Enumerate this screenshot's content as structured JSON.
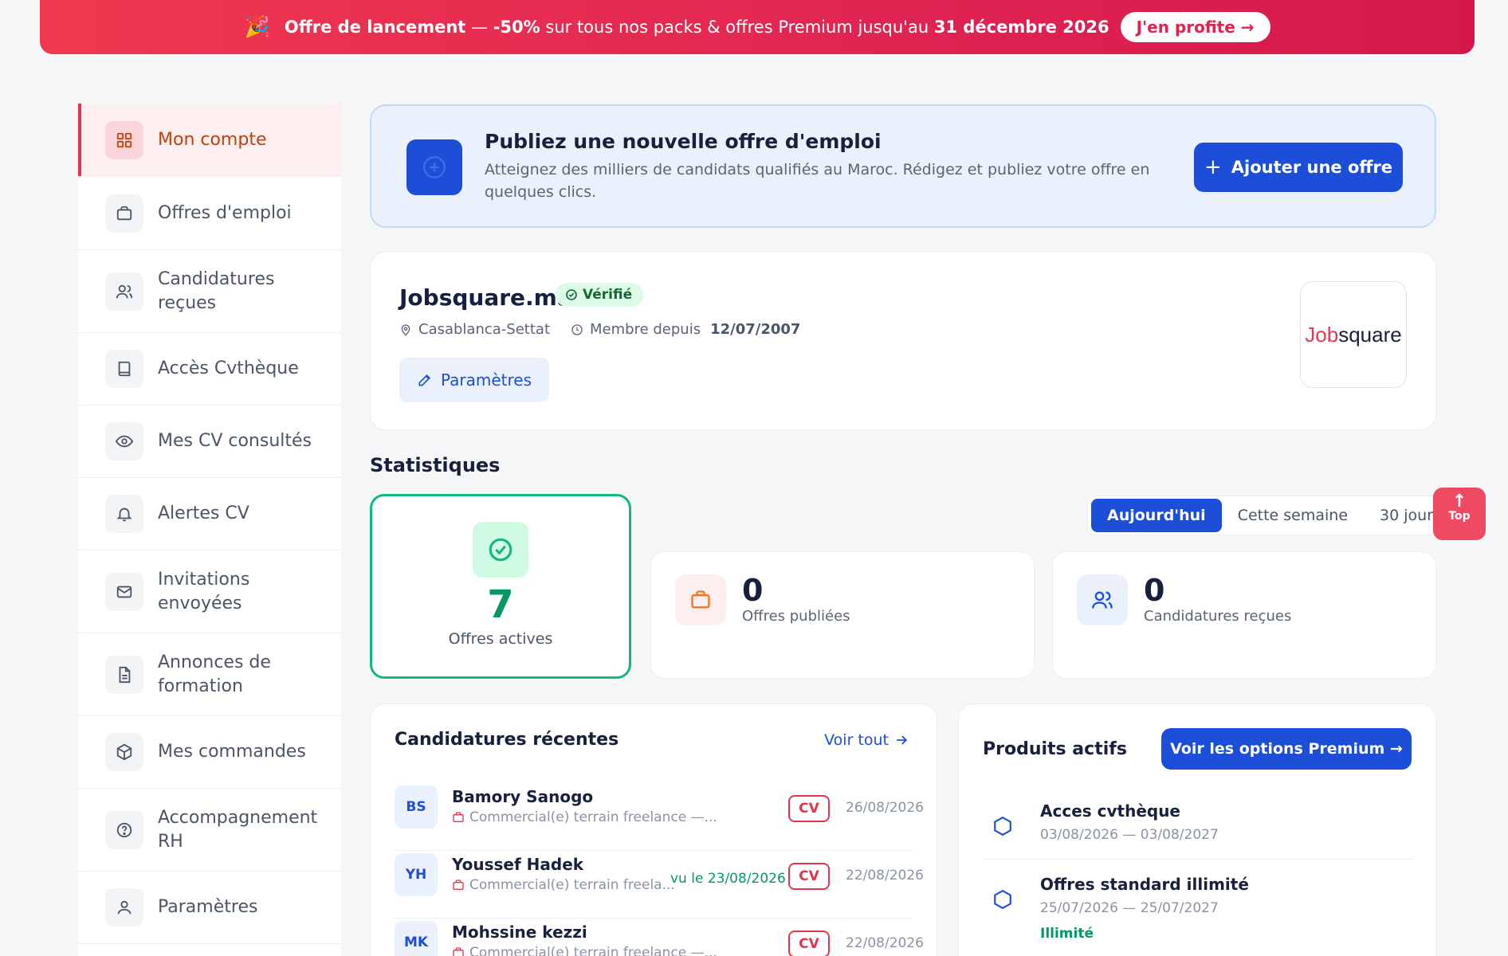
{
  "promo": {
    "icon": "party-popper-icon",
    "bold_title": "Offre de lancement",
    "dash": "—",
    "discount": "-50%",
    "text": "sur tous nos packs & offres Premium jusqu'au",
    "date": "31 décembre 2026",
    "cta": "J'en profite →"
  },
  "sidebar": {
    "items": [
      {
        "label": "Mon compte",
        "icon": "grid-icon"
      },
      {
        "label": "Offres d'emploi",
        "icon": "briefcase-icon"
      },
      {
        "label": "Candidatures reçues",
        "icon": "users-icon"
      },
      {
        "label": "Accès Cvthèque",
        "icon": "book-icon"
      },
      {
        "label": "Mes CV consultés",
        "icon": "eye-icon"
      },
      {
        "label": "Alertes CV",
        "icon": "bell-icon"
      },
      {
        "label": "Invitations envoyées",
        "icon": "mail-icon"
      },
      {
        "label": "Annonces de formation",
        "icon": "document-icon"
      },
      {
        "label": "Mes commandes",
        "icon": "box-icon"
      },
      {
        "label": "Accompagnement RH",
        "icon": "help-circle-icon"
      },
      {
        "label": "Paramètres",
        "icon": "user-icon"
      }
    ]
  },
  "publish": {
    "title": "Publiez une nouvelle offre d'emploi",
    "description": "Atteignez des milliers de candidats qualifiés au Maroc. Rédigez et publiez votre offre en quelques clics.",
    "button": "Ajouter une offre"
  },
  "company": {
    "name": "Jobsquare.ma",
    "verified": "Vérifié",
    "location": "Casablanca-Settat",
    "member_since_label": "Membre depuis",
    "member_since_date": "12/07/2007",
    "settings_button": "Paramètres",
    "logo_part1": "Job",
    "logo_part2": "square"
  },
  "stats": {
    "title": "Statistiques",
    "active": {
      "value": "7",
      "label": "Offres actives"
    },
    "published": {
      "value": "0",
      "label": "Offres publiées"
    },
    "received": {
      "value": "0",
      "label": "Candidatures reçues"
    },
    "periods": [
      "Aujourd'hui",
      "Cette semaine",
      "30 jours"
    ],
    "selected_period": "Aujourd'hui"
  },
  "top_button": {
    "arrow": "↑",
    "label": "Top"
  },
  "recent": {
    "title": "Candidatures récentes",
    "view_all": "Voir tout",
    "items": [
      {
        "initials": "BS",
        "name": "Bamory Sanogo",
        "job": "Commercial(e) terrain freelance —...",
        "seen": "",
        "cv": "CV",
        "date": "26/08/2026"
      },
      {
        "initials": "YH",
        "name": "Youssef Hadek",
        "job": "Commercial(e) terrain freela...",
        "seen": "vu le 23/08/2026",
        "cv": "CV",
        "date": "22/08/2026"
      },
      {
        "initials": "MK",
        "name": "Mohssine kezzi",
        "job": "Commercial(e) terrain freelance —...",
        "seen": "",
        "cv": "CV",
        "date": "22/08/2026"
      }
    ]
  },
  "products": {
    "title": "Produits actifs",
    "button": "Voir les options Premium →",
    "items": [
      {
        "name": "Acces cvthèque",
        "dates": "03/08/2026 — 03/08/2027",
        "unlimited": ""
      },
      {
        "name": "Offres standard illimité",
        "dates": "25/07/2026 — 25/07/2027",
        "unlimited": "Illimité"
      }
    ]
  },
  "colors": {
    "primary": "#1d4ed8",
    "accent": "#e0344f",
    "success": "#059669"
  }
}
